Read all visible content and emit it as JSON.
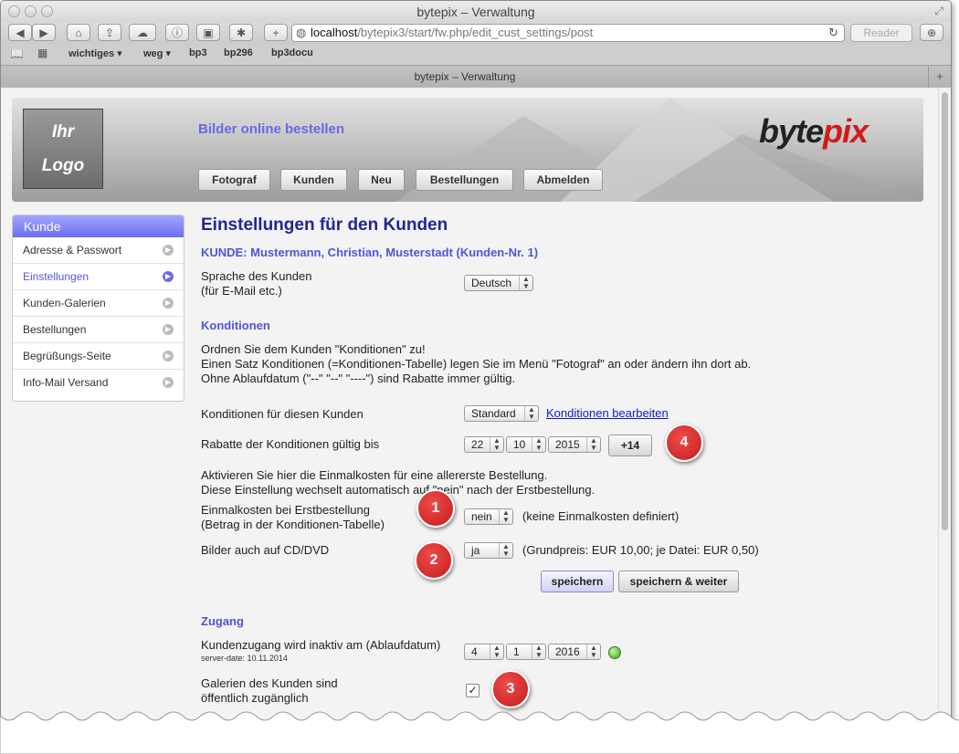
{
  "window": {
    "title": "bytepix – Verwaltung"
  },
  "browser": {
    "url_host": "localhost",
    "url_path": "/bytepix3/start/fw.php/edit_cust_settings/post",
    "reader_label": "Reader",
    "tab_title": "bytepix – Verwaltung",
    "bookmarks": [
      "wichtiges",
      "weg",
      "bp3",
      "bp296",
      "bp3docu"
    ]
  },
  "header": {
    "logo_line1": "Ihr",
    "logo_line2": "Logo",
    "slogan": "Bilder online bestellen",
    "brand_a": "byte",
    "brand_b": "pix",
    "nav": [
      "Fotograf",
      "Kunden",
      "Neu",
      "Bestellungen",
      "Abmelden"
    ]
  },
  "sidebar": {
    "title": "Kunde",
    "items": [
      "Adresse & Passwort",
      "Einstellungen",
      "Kunden-Galerien",
      "Bestellungen",
      "Begrüßungs-Seite",
      "Info-Mail Versand"
    ],
    "active_index": 1
  },
  "main": {
    "title": "Einstellungen für den Kunden",
    "customer": "KUNDE: Mustermann, Christian, Musterstadt (Kunden-Nr. 1)",
    "language_label_1": "Sprache des Kunden",
    "language_label_2": "(für E-Mail etc.)",
    "language_value": "Deutsch",
    "cond_heading": "Konditionen",
    "cond_text_1": "Ordnen Sie dem Kunden \"Konditionen\" zu!",
    "cond_text_2": "Einen Satz Konditionen (=Konditionen-Tabelle) legen Sie im Menü \"Fotograf\" an oder ändern ihn dort ab.",
    "cond_text_3": "Ohne Ablaufdatum (\"--\" \"--\" \"----\") sind Rabatte immer gültig.",
    "cond_for_label": "Konditionen für diesen Kunden",
    "cond_for_value": "Standard",
    "cond_edit_link": "Konditionen bearbeiten",
    "discount_label": "Rabatte der Konditionen gültig bis",
    "discount_day": "22",
    "discount_month": "10",
    "discount_year": "2015",
    "plus14_label": "+14",
    "once_text_1": "Aktivieren Sie hier die Einmalkosten für eine allererste Bestellung.",
    "once_text_2": "Diese Einstellung wechselt automatisch auf \"nein\" nach der Erstbestellung.",
    "once_label_1": "Einmalkosten bei Erstbestellung",
    "once_label_2": "(Betrag in der Konditionen-Tabelle)",
    "once_value": "nein",
    "once_note": "(keine Einmalkosten definiert)",
    "cd_label": "Bilder auch auf CD/DVD",
    "cd_value": "ja",
    "cd_note": "(Grundpreis: EUR 10,00; je Datei: EUR 0,50)",
    "save_label": "speichern",
    "save_next_label": "speichern & weiter",
    "access_heading": "Zugang",
    "access_label": "Kundenzugang wird inaktiv am (Ablaufdatum)",
    "server_date": "server-date: 10.11.2014",
    "access_day": "4",
    "access_month": "1",
    "access_year": "2016",
    "gallery_label_1": "Galerien des Kunden sind",
    "gallery_label_2": "öffentlich zugänglich",
    "gallery_checked": true
  },
  "badges": [
    "1",
    "2",
    "3",
    "4"
  ]
}
